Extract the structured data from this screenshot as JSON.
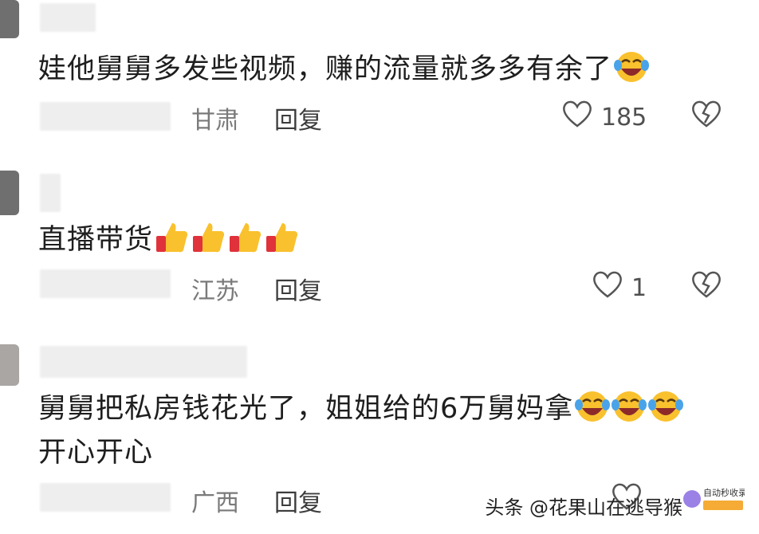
{
  "comments": [
    {
      "text": "娃他舅舅多发些视频，赚的流量就多多有余了",
      "emojis": [
        "laugh-cry-emoji"
      ],
      "location": "甘肃",
      "reply_label": "回复",
      "likes": "185"
    },
    {
      "text": "直播带货",
      "emojis": [
        "thumbs-up-emoji",
        "thumbs-up-emoji",
        "thumbs-up-emoji",
        "thumbs-up-emoji"
      ],
      "location": "江苏",
      "reply_label": "回复",
      "likes": "1"
    },
    {
      "text_line1": "舅舅把私房钱花光了，姐姐给的6万舅妈拿",
      "text_line2": "开心开心",
      "emojis": [
        "laugh-cry-emoji",
        "laugh-cry-emoji",
        "laugh-cry-emoji"
      ],
      "location": "广西",
      "reply_label": "回复",
      "likes": ""
    }
  ],
  "watermark": {
    "text": "头条 @花果山在逃导猴",
    "logo_text": "自动秒收录"
  },
  "colors": {
    "emoji_yellow": "#f9c12e",
    "emoji_mouth": "#8c2a2a",
    "tear_blue": "#4aa3e8",
    "sleeve_red": "#e0323a",
    "icon_gray": "#555555"
  }
}
